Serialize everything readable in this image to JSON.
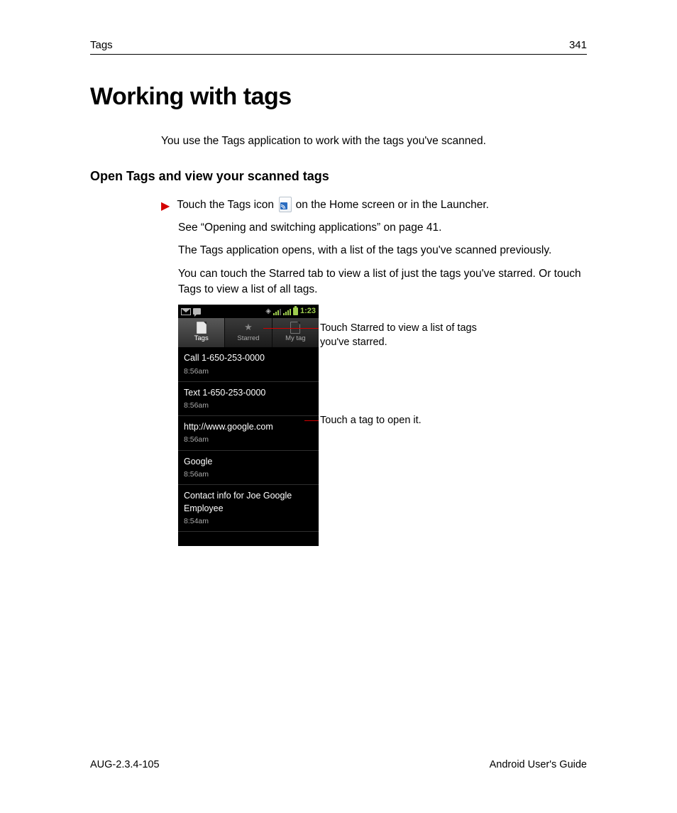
{
  "header": {
    "section": "Tags",
    "page": "341"
  },
  "title": "Working with tags",
  "intro": "You use the Tags application to work with the tags you've scanned.",
  "subheading": "Open Tags and view your scanned tags",
  "step_pre": "Touch the Tags icon ",
  "step_post": " on the Home screen or in the Launcher.",
  "para1": "See “Opening and switching applications” on page 41.",
  "para2": "The Tags application opens, with a list of the tags you've scanned previously.",
  "para3": "You can touch the Starred tab to view a list of just the tags you've starred. Or touch Tags to view a list of all tags.",
  "screenshot": {
    "clock": "1:23",
    "tabs": {
      "tags": "Tags",
      "starred": "Starred",
      "mytag": "My tag"
    },
    "rows": [
      {
        "title": "Call 1-650-253-0000",
        "sub": "8:56am"
      },
      {
        "title": "Text 1-650-253-0000",
        "sub": "8:56am"
      },
      {
        "title": "http://www.google.com",
        "sub": "8:56am"
      },
      {
        "title": "Google",
        "sub": "8:56am"
      },
      {
        "title": "Contact info for Joe Google Employee",
        "sub": "8:54am"
      }
    ]
  },
  "callouts": {
    "c1": "Touch Starred to view a list of tags you've starred.",
    "c2": "Touch a tag to open it."
  },
  "footer": {
    "left": "AUG-2.3.4-105",
    "right": "Android User's Guide"
  }
}
